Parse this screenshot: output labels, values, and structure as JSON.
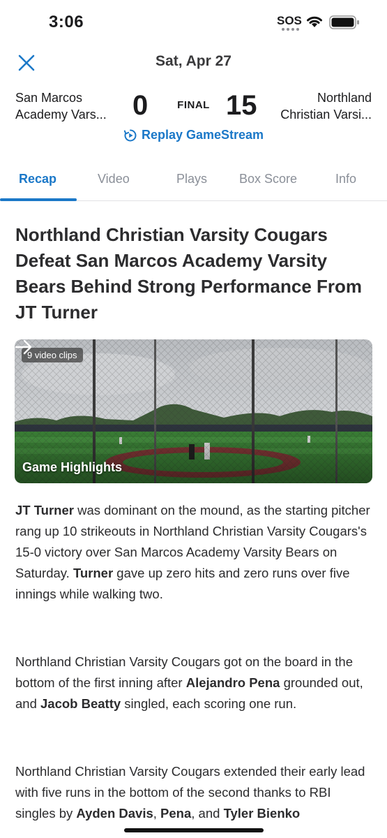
{
  "status_bar": {
    "time": "3:06",
    "sos": "SOS",
    "icons": [
      "signal-dots-icon",
      "wifi-icon",
      "battery-icon"
    ]
  },
  "header": {
    "date": "Sat, Apr 27",
    "close_icon": "close-icon"
  },
  "scoreboard": {
    "away_team_line1": "San Marcos",
    "away_team_line2": "Academy Vars...",
    "away_score": "0",
    "status": "FINAL",
    "home_score": "15",
    "home_team_line1": "Northland",
    "home_team_line2": "Christian Varsi..."
  },
  "replay": {
    "label": "Replay GameStream",
    "icon": "replay-icon"
  },
  "tabs": [
    {
      "label": "Recap",
      "active": true
    },
    {
      "label": "Video",
      "active": false
    },
    {
      "label": "Plays",
      "active": false
    },
    {
      "label": "Box Score",
      "active": false
    },
    {
      "label": "Info",
      "active": false
    }
  ],
  "article": {
    "headline": "Northland Christian Varsity Cougars Defeat San Marcos Academy Varsity Bears Behind Strong Performance From JT Turner",
    "video": {
      "badge": "9 video clips",
      "label": "Game Highlights",
      "icon": "arrow-right-icon"
    },
    "p1": {
      "b1": "JT Turner",
      "t1": " was dominant on the mound, as the starting pitcher rang up 10 strikeouts in Northland Christian Varsity Cougars's 15-0 victory over San Marcos Academy Varsity Bears on Saturday. ",
      "b2": "Turner",
      "t2": " gave up zero hits and zero runs over five innings while walking two."
    },
    "p2": {
      "t1": "Northland Christian Varsity Cougars got on the board in the bottom of the first inning after ",
      "b1": "Alejandro Pena",
      "t2": " grounded out, and ",
      "b2": "Jacob Beatty",
      "t3": " singled, each scoring one run."
    },
    "p3": {
      "t1": "Northland Christian Varsity Cougars extended their early lead with five runs in the bottom of the second thanks to RBI singles by ",
      "b1": "Ayden Davis",
      "t2": ", ",
      "b2": "Pena",
      "t3": ", and ",
      "b3": "Tyler Bienko"
    }
  },
  "colors": {
    "accent": "#1b78c8",
    "text": "#2c2c2e",
    "muted": "#8a8f98"
  }
}
